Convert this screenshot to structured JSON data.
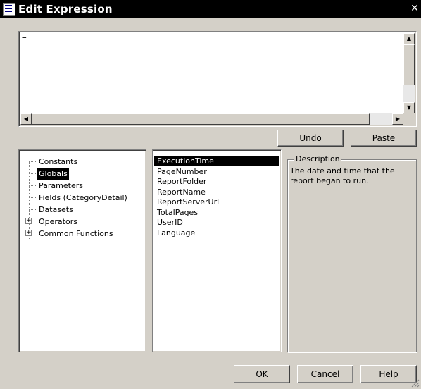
{
  "window": {
    "title": "Edit Expression",
    "close_glyph": "✕"
  },
  "expression": {
    "value": "="
  },
  "edit_buttons": {
    "undo": "Undo",
    "paste": "Paste"
  },
  "tree": {
    "items": [
      {
        "label": "Constants",
        "expandable": false,
        "selected": false
      },
      {
        "label": "Globals",
        "expandable": false,
        "selected": true
      },
      {
        "label": "Parameters",
        "expandable": false,
        "selected": false
      },
      {
        "label": "Fields (CategoryDetail)",
        "expandable": false,
        "selected": false
      },
      {
        "label": "Datasets",
        "expandable": false,
        "selected": false
      },
      {
        "label": "Operators",
        "expandable": true,
        "selected": false
      },
      {
        "label": "Common Functions",
        "expandable": true,
        "selected": false
      }
    ]
  },
  "list": {
    "items": [
      {
        "label": "ExecutionTime",
        "selected": true
      },
      {
        "label": "PageNumber",
        "selected": false
      },
      {
        "label": "ReportFolder",
        "selected": false
      },
      {
        "label": "ReportName",
        "selected": false
      },
      {
        "label": "ReportServerUrl",
        "selected": false
      },
      {
        "label": "TotalPages",
        "selected": false
      },
      {
        "label": "UserID",
        "selected": false
      },
      {
        "label": "Language",
        "selected": false
      }
    ]
  },
  "description": {
    "legend": "Description",
    "text": "The date and time that the report began to run."
  },
  "footer": {
    "ok": "OK",
    "cancel": "Cancel",
    "help": "Help"
  },
  "icons": {
    "window_icon": "report-icon",
    "close": "close-icon",
    "scroll_up": "arrow-up-icon",
    "scroll_down": "arrow-down-icon",
    "scroll_left": "arrow-left-icon",
    "scroll_right": "arrow-right-icon",
    "expand": "plus-icon",
    "resize": "size-grip-icon"
  },
  "colors": {
    "face": "#d4d0c8",
    "title_bar": "#000000",
    "selection": "#000000"
  }
}
